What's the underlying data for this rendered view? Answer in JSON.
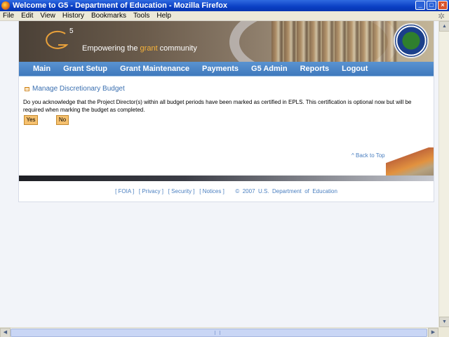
{
  "window": {
    "title": "Welcome to G5 - Department of Education - Mozilla Firefox",
    "buttons": {
      "minimize": "_",
      "maximize": "□",
      "close": "×"
    }
  },
  "menubar": {
    "items": [
      {
        "label": "File"
      },
      {
        "label": "Edit"
      },
      {
        "label": "View"
      },
      {
        "label": "History"
      },
      {
        "label": "Bookmarks"
      },
      {
        "label": "Tools"
      },
      {
        "label": "Help"
      }
    ]
  },
  "banner": {
    "logo_text": "G",
    "logo_superscript": "5",
    "tagline_prefix": "Empowering the ",
    "tagline_highlight": "grant",
    "tagline_suffix": " community"
  },
  "nav": {
    "items": [
      {
        "label": "Main"
      },
      {
        "label": "Grant Setup"
      },
      {
        "label": "Grant Maintenance"
      },
      {
        "label": "Payments"
      },
      {
        "label": "G5 Admin"
      },
      {
        "label": "Reports"
      },
      {
        "label": "Logout"
      }
    ]
  },
  "main": {
    "section_title": "Manage Discretionary Budget",
    "message": "Do you acknowledge that the Project Director(s) within all budget periods have been marked as certified in EPLS. This certification is optional now but will be required when marking the budget as completed.",
    "yes_label": "Yes",
    "no_label": "No",
    "back_to_top": "^ Back to Top"
  },
  "footer": {
    "foia": "[ FOIA ]",
    "privacy": "[ Privacy ]",
    "security": "[ Security ]",
    "notices": "[ Notices ]",
    "copyright": "©  2007  U.S.  Department  of  Education"
  },
  "colors": {
    "nav_bg": "#4a85c8",
    "link": "#4a7fc0",
    "button_bg": "#f6c16f",
    "title_bar": "#0a3fc4"
  },
  "icons": [
    "firefox-icon",
    "minimize-icon",
    "maximize-icon",
    "close-icon",
    "throbber-icon",
    "bullet-icon",
    "department-seal-icon",
    "g5-logo"
  ]
}
